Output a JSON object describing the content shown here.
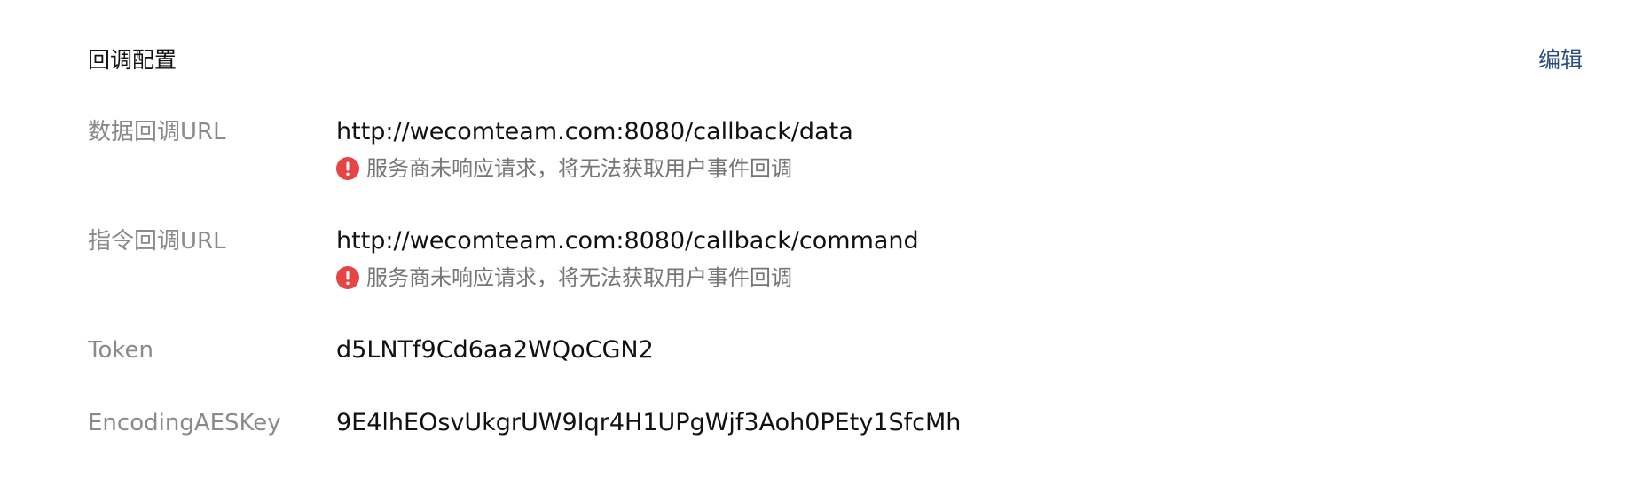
{
  "header": {
    "title": "回调配置",
    "edit_label": "编辑"
  },
  "rows": [
    {
      "label": "数据回调URL",
      "value": "http://wecomteam.com:8080/callback/data",
      "warning": "服务商未响应请求，将无法获取用户事件回调"
    },
    {
      "label": "指令回调URL",
      "value": "http://wecomteam.com:8080/callback/command",
      "warning": "服务商未响应请求，将无法获取用户事件回调"
    },
    {
      "label": "Token",
      "value": "d5LNTf9Cd6aa2WQoCGN2"
    },
    {
      "label": "EncodingAESKey",
      "value": "9E4lhEOsvUkgrUW9Iqr4H1UPgWjf3Aoh0PEty1SfcMh"
    }
  ],
  "colors": {
    "warning_icon": "#e54545",
    "link": "#2a4e7f",
    "label": "#8a8a8a",
    "value": "#111111"
  },
  "icons": {
    "warning": "exclamation-circle-icon"
  }
}
